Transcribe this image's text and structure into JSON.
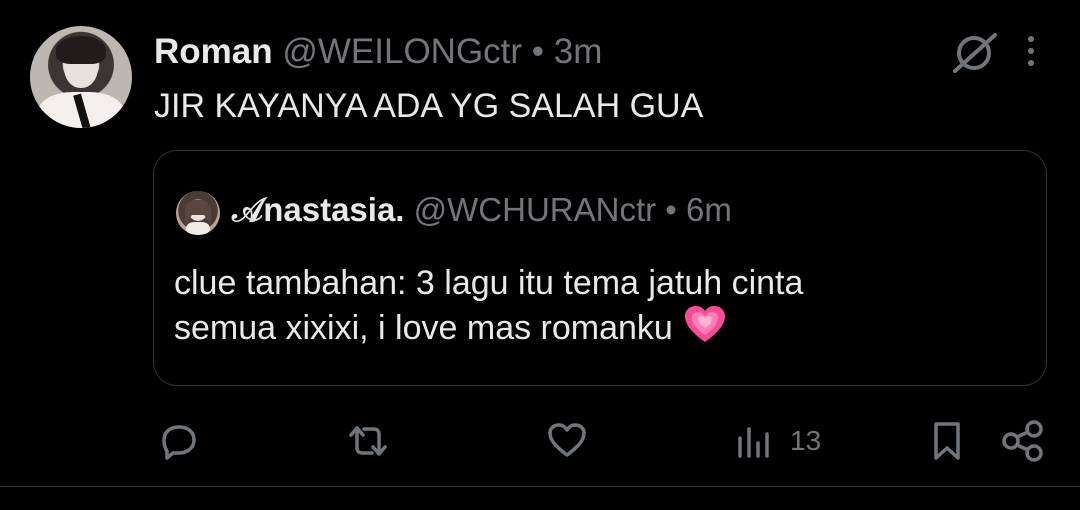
{
  "tweet": {
    "author_name": "Roman",
    "handle": "@WEILONGctr",
    "separator": "•",
    "time": "3m",
    "text": "JIR KAYANYA ADA YG SALAH GUA"
  },
  "quote": {
    "author_name": "𝒜nastasia.",
    "handle": "@WCHURANctr",
    "separator": "•",
    "time": "6m",
    "text_line_1": "clue tambahan: 3 lagu itu tema jatuh cinta",
    "text_line_2": "semua xixixi, i love mas romanku"
  },
  "stats": {
    "views": "13"
  },
  "icons": {
    "grok": "grok-icon",
    "more": "more-icon",
    "reply": "reply-icon",
    "retweet": "retweet-icon",
    "like": "like-icon",
    "views": "views-icon",
    "bookmark": "bookmark-icon",
    "share": "share-icon",
    "emoji": "growing-heart-emoji"
  },
  "colors": {
    "background": "#000000",
    "text": "#e7e9ea",
    "secondary": "#71767b",
    "border": "#2f3336",
    "heart": "#ff4f9a"
  }
}
